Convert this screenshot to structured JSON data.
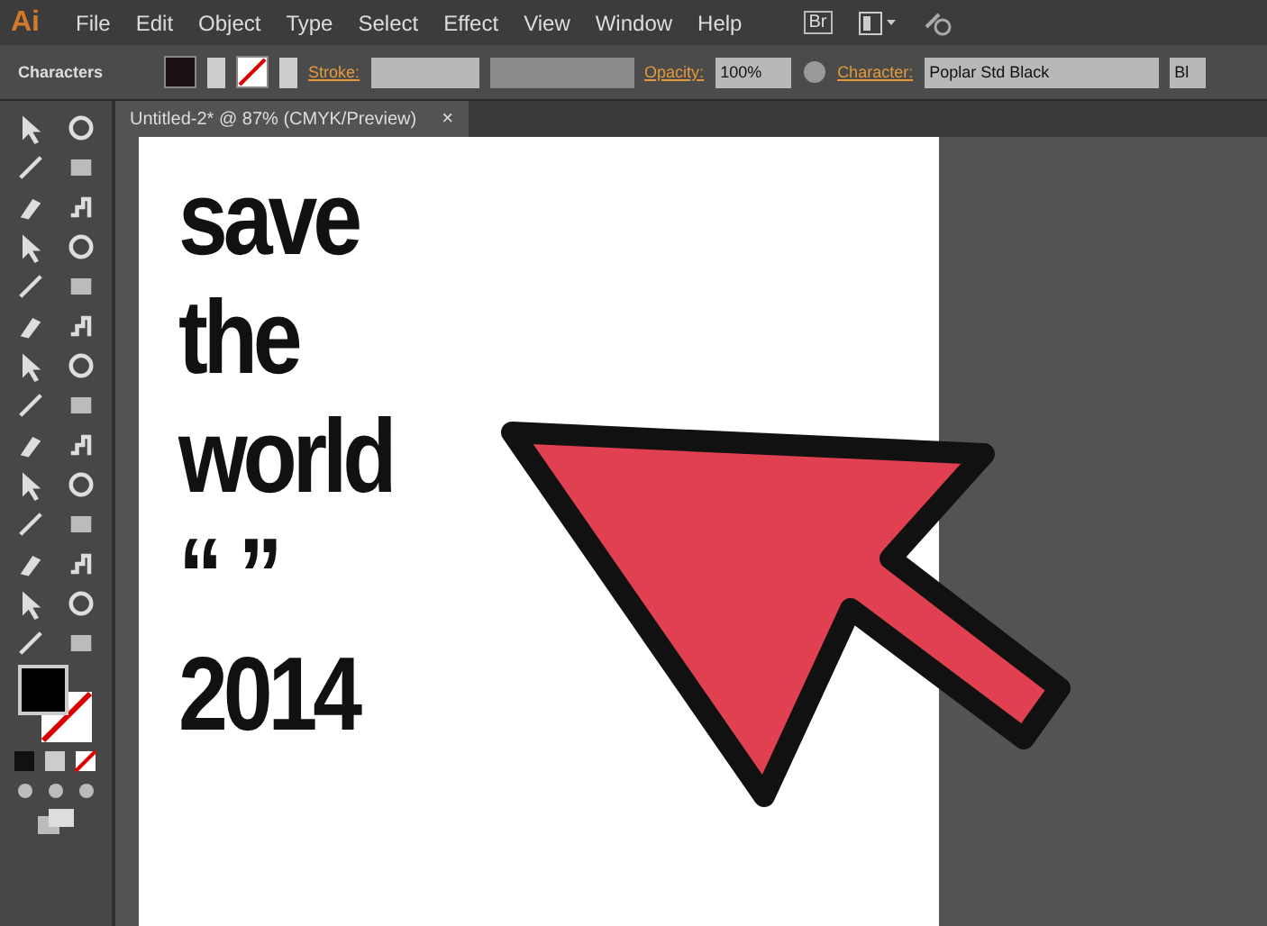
{
  "app_logo": "Ai",
  "menu": [
    "File",
    "Edit",
    "Object",
    "Type",
    "Select",
    "Effect",
    "View",
    "Window",
    "Help"
  ],
  "bridge_button": "Br",
  "control_bar": {
    "panel_label": "Characters",
    "stroke_label": "Stroke:",
    "opacity_label": "Opacity:",
    "opacity_value": "100%",
    "character_label": "Character:",
    "font_value": "Poplar Std Black",
    "style_value": "Bl"
  },
  "document_tab": {
    "title": "Untitled-2* @ 87% (CMYK/Preview)",
    "close": "×",
    "selected": true
  },
  "artboard_lines": [
    "save",
    "the",
    "world",
    "“ ”",
    "2014"
  ]
}
